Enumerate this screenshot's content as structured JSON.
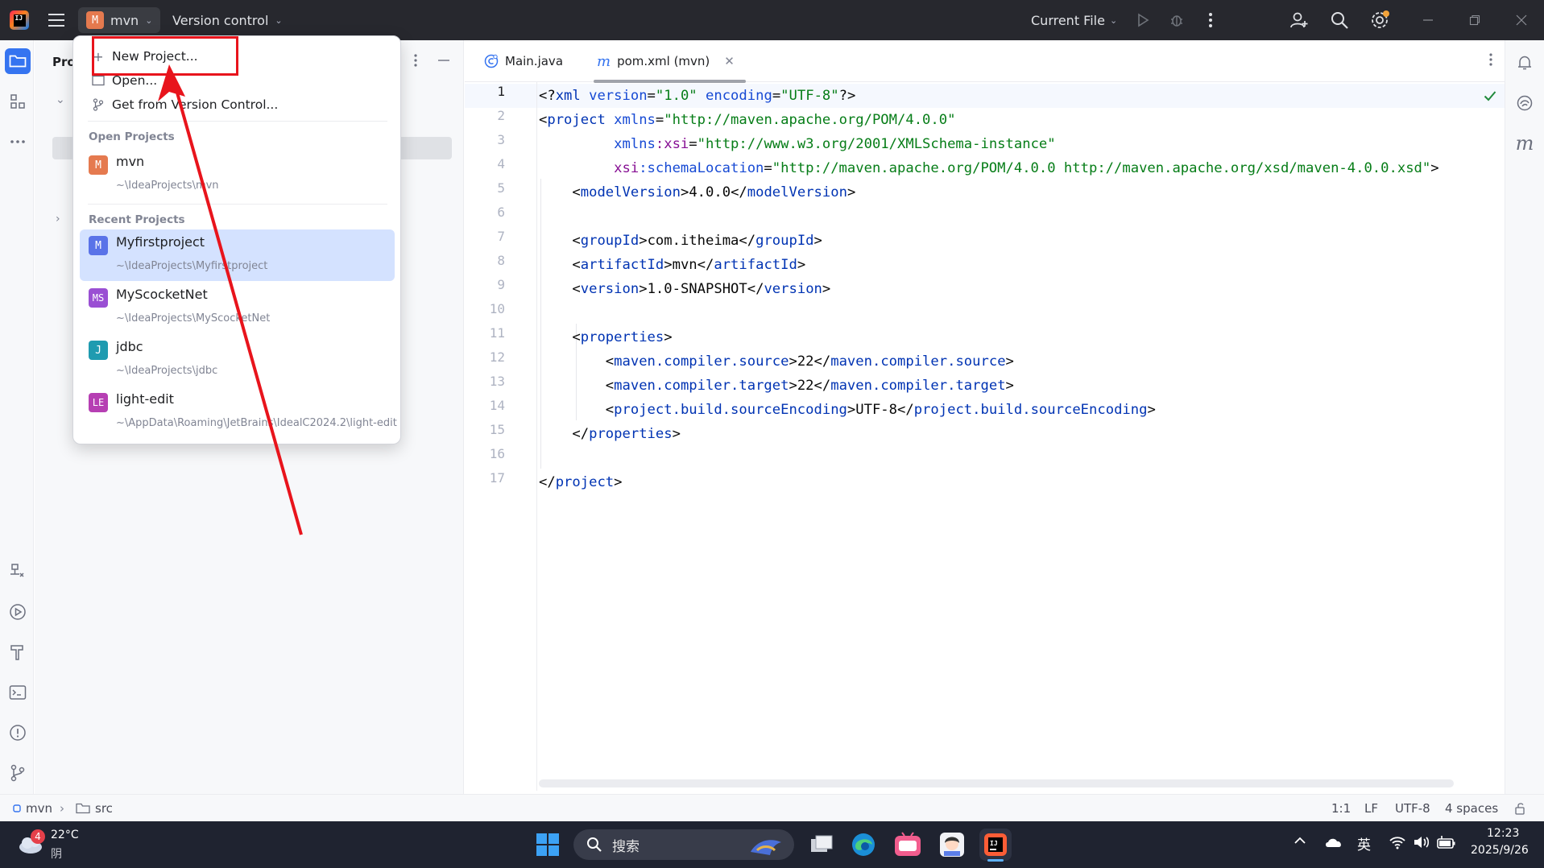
{
  "titlebar": {
    "project_badge": "M",
    "project_name": "mvn",
    "vcs_label": "Version control",
    "run_config": "Current File"
  },
  "project_panel": {
    "title": "Pro"
  },
  "editor": {
    "tabs": [
      {
        "label": "Main.java",
        "active": false
      },
      {
        "label": "pom.xml (mvn)",
        "active": true
      }
    ],
    "line_numbers": [
      "1",
      "2",
      "3",
      "4",
      "5",
      "6",
      "7",
      "8",
      "9",
      "10",
      "11",
      "12",
      "13",
      "14",
      "15",
      "16",
      "17"
    ],
    "code": {
      "l1_prolog_open": "<?",
      "l1_xml": "xml",
      "l1_version_attr": "version",
      "l1_version_val": "\"1.0\"",
      "l1_encoding_attr": "encoding",
      "l1_encoding_val": "\"UTF-8\"",
      "l1_prolog_close": "?>",
      "l2_open": "<",
      "l2_tag": "project",
      "l2_attr": "xmlns",
      "l2_val": "\"http://maven.apache.org/POM/4.0.0\"",
      "l3_ns": "xmlns",
      "l3_attr": ":xsi",
      "l3_val": "\"http://www.w3.org/2001/XMLSchema-instance\"",
      "l4_ns": "xsi",
      "l4_attr": ":schemaLocation",
      "l4_val": "\"http://maven.apache.org/POM/4.0.0 http://maven.apache.org/xsd/maven-4.0.0.xsd\"",
      "l4_close": ">",
      "l5_tag": "modelVersion",
      "l5_text": "4.0.0",
      "l7_tag": "groupId",
      "l7_text": "com.itheima",
      "l8_tag": "artifactId",
      "l8_text": "mvn",
      "l9_tag": "version",
      "l9_text": "1.0-SNAPSHOT",
      "l11_tag": "properties",
      "l12_tag": "maven.compiler.source",
      "l12_text": "22",
      "l13_tag": "maven.compiler.target",
      "l13_text": "22",
      "l14_tag": "project.build.sourceEncoding",
      "l14_text": "UTF-8",
      "l15_tag": "properties",
      "l17_tag": "project",
      "lt": "<",
      "lts": "</",
      "gt": ">"
    }
  },
  "popup": {
    "new_project": "New Project...",
    "open": "Open...",
    "get_from_vcs": "Get from Version Control...",
    "open_projects_header": "Open Projects",
    "recent_projects_header": "Recent Projects",
    "open_projects": [
      {
        "badge": "M",
        "name": "mvn",
        "path": "~\\IdeaProjects\\mvn",
        "color": "#e57a4f"
      }
    ],
    "recent_projects": [
      {
        "badge": "M",
        "name": "Myfirstproject",
        "path": "~\\IdeaProjects\\Myfirstproject",
        "color": "#5a73e8"
      },
      {
        "badge": "MS",
        "name": "MyScocketNet",
        "path": "~\\IdeaProjects\\MyScocketNet",
        "color": "#9a4fd3"
      },
      {
        "badge": "J",
        "name": "jdbc",
        "path": "~\\IdeaProjects\\jdbc",
        "color": "#1f9bb0"
      },
      {
        "badge": "LE",
        "name": "light-edit",
        "path": "~\\AppData\\Roaming\\JetBrains\\IdealC2024.2\\light-edit",
        "color": "#b63fb3"
      }
    ]
  },
  "statusbar": {
    "breadcrumb_project": "mvn",
    "breadcrumb_folder": "src",
    "position": "1:1",
    "line_sep": "LF",
    "encoding": "UTF-8",
    "indent": "4 spaces"
  },
  "taskbar": {
    "weather_badge": "4",
    "temperature": "22°C",
    "condition": "阴",
    "search_placeholder": "搜索",
    "ime": "英",
    "time": "12:23",
    "date": "2025/9/26"
  },
  "colors": {
    "accent": "#3574f0",
    "annotation": "#e8141c",
    "titlebar_bg": "#27282e",
    "taskbar_bg": "#1f2330"
  }
}
